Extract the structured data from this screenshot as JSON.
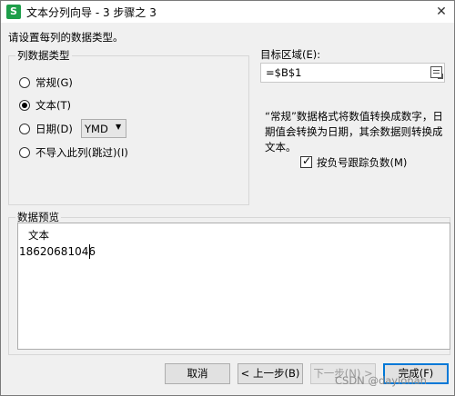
{
  "window": {
    "title": "文本分列向导 - 3 步骤之 3",
    "app_icon": "S",
    "close_glyph": "✕"
  },
  "instruction": "请设置每列的数据类型。",
  "column_type": {
    "legend": "列数据类型",
    "options": [
      {
        "label": "常规(G)",
        "selected": false
      },
      {
        "label": "文本(T)",
        "selected": true
      },
      {
        "label": "日期(D)",
        "selected": false
      },
      {
        "label": "不导入此列(跳过)(I)",
        "selected": false
      }
    ],
    "date_format": "YMD"
  },
  "destination": {
    "label": "目标区域(E):",
    "value": "=$B$1"
  },
  "description": "“常规”数据格式将数值转换成数字，日期值会转换为日期，其余数据则转换成文本。",
  "negative_option": {
    "label": "按负号跟踪负数(M)",
    "checked": true
  },
  "preview": {
    "legend": "数据预览",
    "header": "文本",
    "rows": [
      "18620681046"
    ]
  },
  "buttons": {
    "cancel": "取消",
    "back": "< 上一步(B)",
    "next": "下一步(N) >",
    "finish": "完成(F)"
  },
  "watermark": "CSDN @daylonan"
}
